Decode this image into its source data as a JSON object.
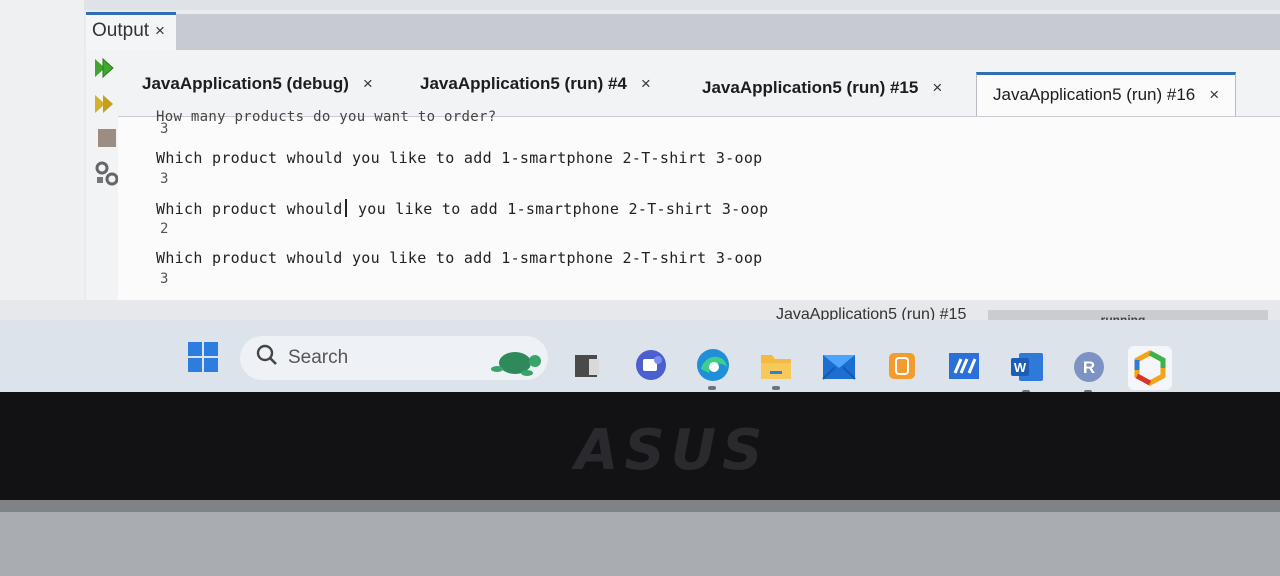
{
  "output_window": {
    "title": "Output",
    "close": "×"
  },
  "tabs": [
    {
      "label": "JavaApplication5 (debug)",
      "close": "×",
      "active": false
    },
    {
      "label": "JavaApplication5 (run) #4",
      "close": "×",
      "active": false
    },
    {
      "label": "JavaApplication5 (run) #15",
      "close": "×",
      "active": false
    },
    {
      "label": "JavaApplication5 (run) #16",
      "close": "×",
      "active": true
    }
  ],
  "side_toolbar": [
    "rerun-icon",
    "rerun-with-options-icon",
    "stop-icon",
    "settings-icon"
  ],
  "console": {
    "clipped_line": "How many products do you want to order?",
    "lines": [
      {
        "text": "3",
        "kind": "input"
      },
      {
        "text": "Which product whould you like to add 1-smartphone 2-T-shirt 3-oop",
        "kind": "output"
      },
      {
        "text": "3",
        "kind": "input"
      },
      {
        "text_before_caret": "Which product whould",
        "text_after_caret": " you like to add 1-smartphone 2-T-shirt 3-oop",
        "kind": "output"
      },
      {
        "text": "2",
        "kind": "input"
      },
      {
        "text": "Which product whould you like to add 1-smartphone 2-T-shirt 3-oop",
        "kind": "output"
      },
      {
        "text": "3",
        "kind": "input"
      }
    ]
  },
  "status": {
    "task": "JavaApplication5 (run) #15",
    "progress_text": "running...",
    "progress": 0.0
  },
  "taskbar": {
    "search_placeholder": "Search",
    "icons": [
      "windows-start-icon",
      "search-icon",
      "turtle-widget-icon",
      "file-explorer-icon",
      "teams-chat-icon",
      "edge-icon",
      "folder-icon",
      "mail-icon",
      "sticky-notes-icon",
      "ms-store-icon",
      "word-icon",
      "r-icon",
      "colorful-hexagon-icon"
    ],
    "word_letter": "W",
    "r_letter": "R"
  },
  "bezel": {
    "brand": "ASUS"
  },
  "colors": {
    "accent_blue": "#2f6fb5",
    "progress_gray": "#c9ccd0"
  }
}
